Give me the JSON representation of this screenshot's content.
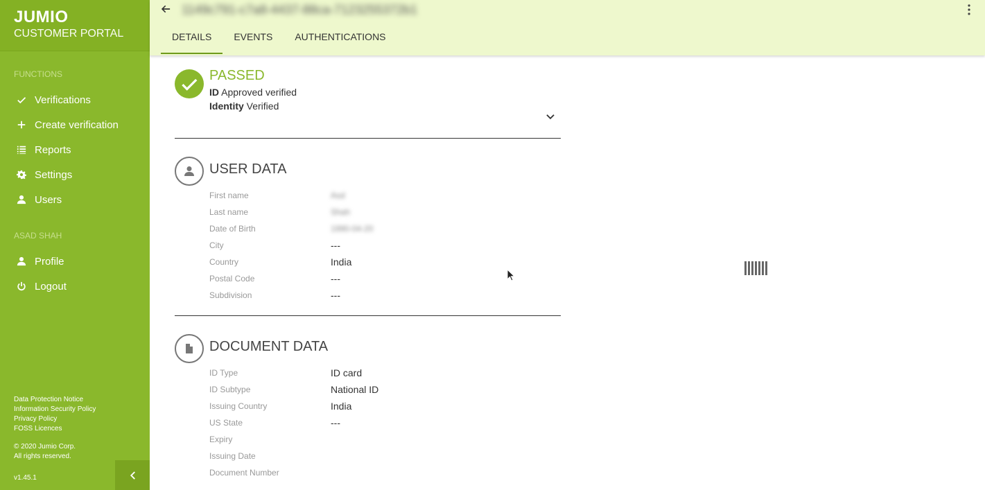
{
  "sidebar": {
    "brand": "JUMIO",
    "subtitle": "CUSTOMER PORTAL",
    "functions_title": "FUNCTIONS",
    "functions": [
      {
        "label": "Verifications",
        "icon": "check-icon"
      },
      {
        "label": "Create verification",
        "icon": "plus-icon"
      },
      {
        "label": "Reports",
        "icon": "list-icon"
      },
      {
        "label": "Settings",
        "icon": "gear-icon"
      },
      {
        "label": "Users",
        "icon": "user-icon"
      }
    ],
    "user_title": "ASAD SHAH",
    "user_items": [
      {
        "label": "Profile",
        "icon": "user-icon"
      },
      {
        "label": "Logout",
        "icon": "power-icon"
      }
    ],
    "footer_links": [
      "Data Protection Notice",
      "Information Security Policy",
      "Privacy Policy",
      "FOSS Licences"
    ],
    "copyright_line1": "© 2020 Jumio Corp.",
    "copyright_line2": "All rights reserved.",
    "version": "v1.45.1"
  },
  "header": {
    "transaction_id": "1149c791-c7a8-4437-88ca-7123255372b1",
    "tabs": [
      "DETAILS",
      "EVENTS",
      "AUTHENTICATIONS"
    ]
  },
  "status": {
    "title": "PASSED",
    "line1_key": "ID",
    "line1_val": "Approved verified",
    "line2_key": "Identity",
    "line2_val": "Verified"
  },
  "user_data": {
    "title": "USER DATA",
    "rows": [
      {
        "label": "First name",
        "value": "Asd"
      },
      {
        "label": "Last name",
        "value": "Shah"
      },
      {
        "label": "Date of Birth",
        "value": "1990-04-20"
      },
      {
        "label": "City",
        "value": "---"
      },
      {
        "label": "Country",
        "value": "India"
      },
      {
        "label": "Postal Code",
        "value": "---"
      },
      {
        "label": "Subdivision",
        "value": "---"
      }
    ]
  },
  "document_data": {
    "title": "DOCUMENT DATA",
    "rows": [
      {
        "label": "ID Type",
        "value": "ID card"
      },
      {
        "label": "ID Subtype",
        "value": "National ID"
      },
      {
        "label": "Issuing Country",
        "value": "India"
      },
      {
        "label": "US State",
        "value": "---"
      },
      {
        "label": "Expiry",
        "value": ""
      },
      {
        "label": "Issuing Date",
        "value": ""
      },
      {
        "label": "Document Number",
        "value": ""
      }
    ]
  },
  "colors": {
    "sidebar": "#8ab82c",
    "header": "#eef8cd",
    "accent": "#8ab82c"
  }
}
